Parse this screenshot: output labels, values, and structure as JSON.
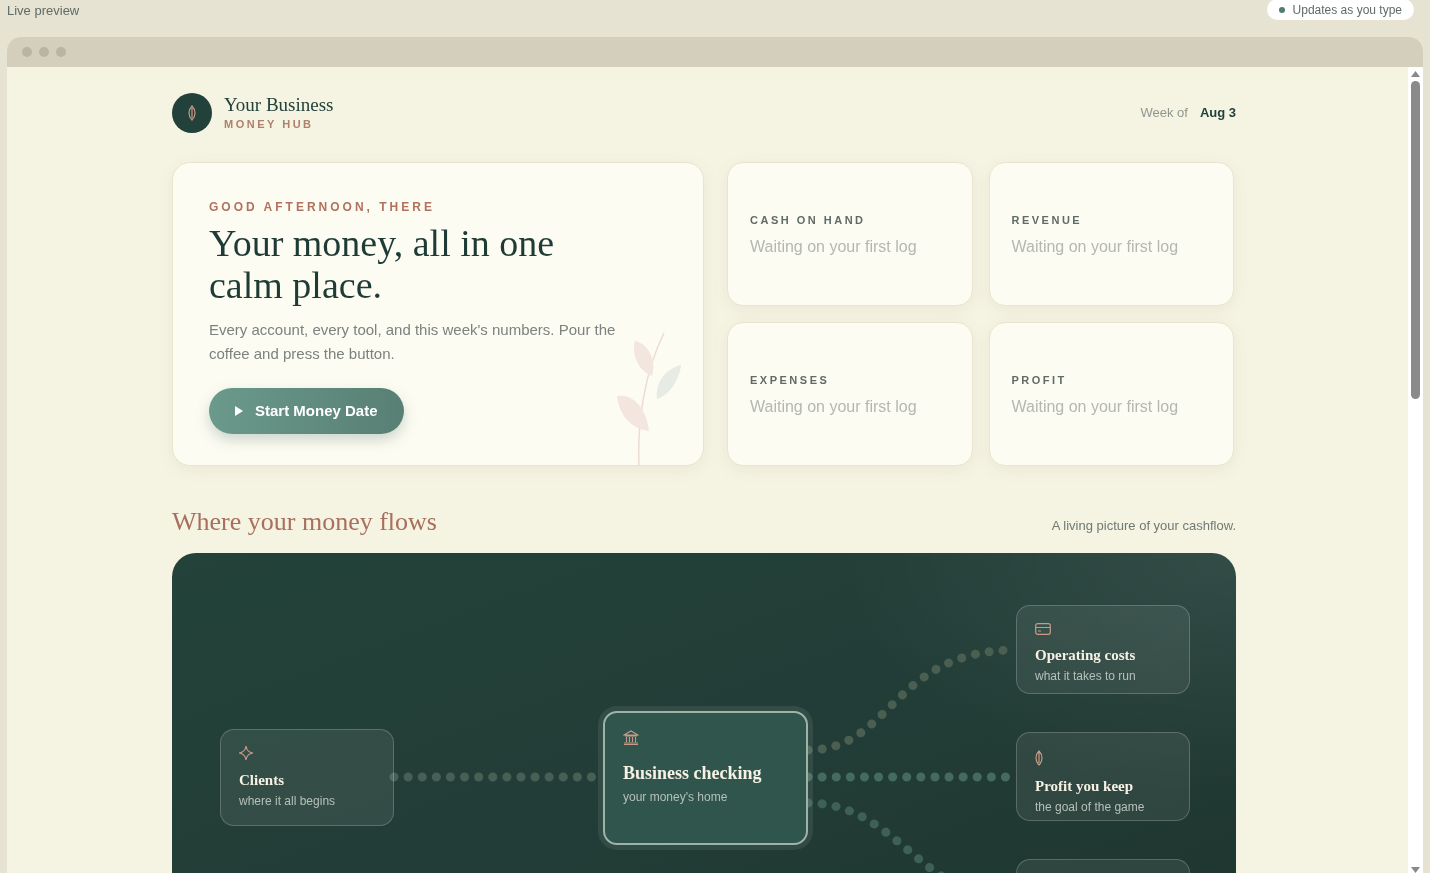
{
  "top_bar": {
    "label": "Live preview",
    "status": "Updates as you type"
  },
  "header": {
    "brand": "Your Business",
    "subtitle": "MONEY HUB",
    "week_label": "Week of",
    "week_value": "Aug 3"
  },
  "hero": {
    "eyebrow": "GOOD AFTERNOON, THERE",
    "title": "Your money, all in one calm place.",
    "body": "Every account, every tool, and this week's numbers. Pour the coffee and press the button.",
    "button": "Start Money Date"
  },
  "stats": [
    {
      "label": "CASH ON HAND",
      "value": "Waiting on your first log"
    },
    {
      "label": "REVENUE",
      "value": "Waiting on your first log"
    },
    {
      "label": "EXPENSES",
      "value": "Waiting on your first log"
    },
    {
      "label": "PROFIT",
      "value": "Waiting on your first log"
    }
  ],
  "flow": {
    "title": "Where your money flows",
    "caption": "A living picture of your cashflow.",
    "nodes": [
      {
        "kind": "source",
        "title": "Clients",
        "subtitle": "where it all begins"
      },
      {
        "kind": "hub",
        "title": "Business checking",
        "subtitle": "your money's home"
      },
      {
        "kind": "costs",
        "title": "Operating costs",
        "subtitle": "what it takes to run"
      },
      {
        "kind": "profit",
        "title": "Profit you keep",
        "subtitle": "the goal of the game"
      },
      {
        "kind": "outflow"
      }
    ]
  }
}
